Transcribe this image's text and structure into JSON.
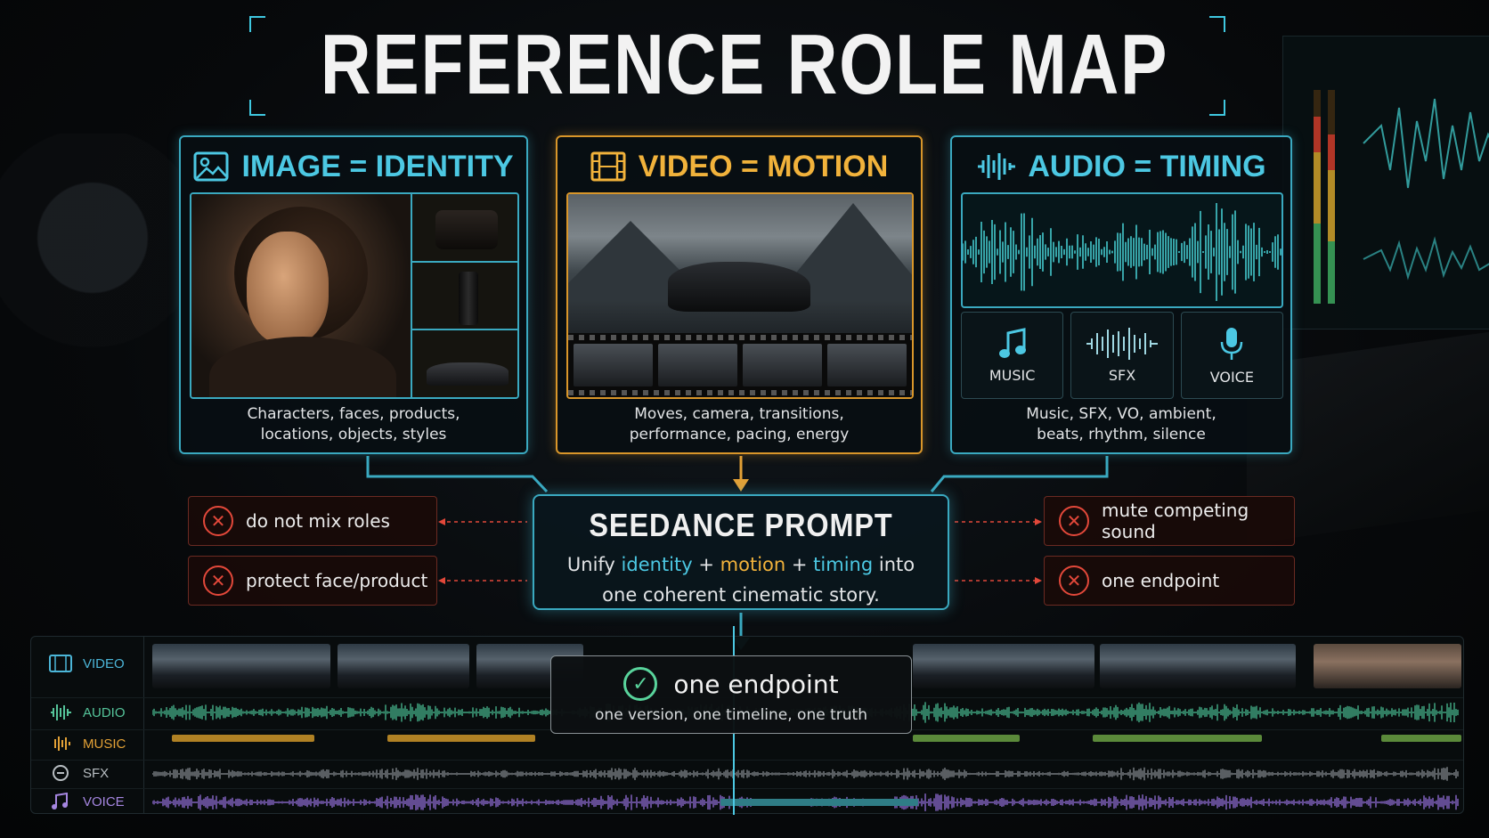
{
  "title": "REFERENCE ROLE MAP",
  "cards": {
    "image": {
      "heading": "IMAGE = IDENTITY",
      "desc_line1": "Characters, faces, products,",
      "desc_line2": "locations, objects, styles"
    },
    "video": {
      "heading": "VIDEO = MOTION",
      "desc_line1": "Moves, camera, transitions,",
      "desc_line2": "performance, pacing, energy"
    },
    "audio": {
      "heading": "AUDIO = TIMING",
      "tiles": [
        "MUSIC",
        "SFX",
        "VOICE"
      ],
      "desc_line1": "Music, SFX, VO, ambient,",
      "desc_line2": "beats, rhythm, silence"
    }
  },
  "central": {
    "title": "SEEDANCE PROMPT",
    "unify": "Unify",
    "identity": "identity",
    "plus": "+",
    "motion": "motion",
    "timing": "timing",
    "into": "into",
    "line2": "one coherent cinematic story."
  },
  "warnings_left": [
    "do not mix roles",
    "protect face/product"
  ],
  "warnings_right": [
    "mute competing sound",
    "one endpoint"
  ],
  "timeline": {
    "tracks": [
      "VIDEO",
      "AUDIO",
      "MUSIC",
      "SFX",
      "VOICE"
    ],
    "endpoint_title": "one endpoint",
    "endpoint_sub": "one version, one timeline, one truth"
  },
  "colors": {
    "cyan": "#3aa9c0",
    "orange": "#d9962a",
    "red": "#e2483a",
    "green": "#59d49c",
    "purple": "#8f6bd1"
  },
  "icons": {
    "image": "image-icon",
    "video": "film-icon",
    "audio": "waveform-icon",
    "music": "music-note-icon",
    "sfx": "sfx-wave-icon",
    "voice": "microphone-icon",
    "warning": "x-circle-icon",
    "endpoint": "check-circle-icon"
  }
}
